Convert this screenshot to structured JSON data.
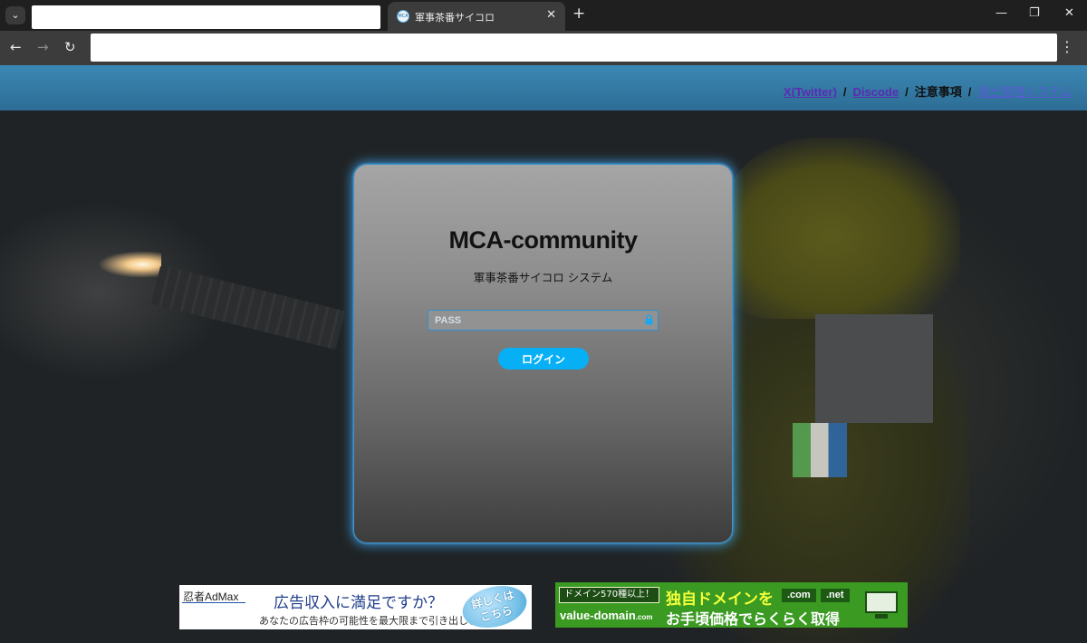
{
  "browser": {
    "tab_title": "軍事茶番サイコロ",
    "favicon_text": "MCA",
    "new_tab_symbol": "+",
    "close_tab_symbol": "✕",
    "window_controls": {
      "minimize": "—",
      "restore": "❐",
      "close": "✕"
    },
    "nav": {
      "back": "←",
      "forward": "→",
      "reload": "↻"
    },
    "menu_symbol": "⋮",
    "tab_search_symbol": "⌄"
  },
  "header": {
    "links": [
      {
        "label": "X(Twitter)"
      },
      {
        "label": "Discode"
      },
      {
        "label": "注意事項"
      },
      {
        "label": "領土管理システム"
      }
    ],
    "separator": "/"
  },
  "login": {
    "title": "MCA-community",
    "subtitle": "軍事茶番サイコロ システム",
    "password_placeholder": "PASS",
    "password_value": "",
    "submit_label": "ログイン"
  },
  "ads": {
    "admax": {
      "brand": "忍者AdMax",
      "headline": "広告収入に満足ですか？",
      "subtext": "あなたの広告枠の可能性を最大限まで引き出します",
      "cta": [
        "詳しくは",
        "こちら"
      ]
    },
    "value_domain": {
      "tag": "ドメイン570種以上！",
      "brand": "value-domain",
      "brand_suffix": ".com",
      "headline": "独自ドメインを",
      "subtext": "お手頃価格でらくらく取得",
      "tlds": [
        ".com",
        ".net"
      ]
    }
  },
  "colors": {
    "header_bg": "#3b88b4",
    "card_glow": "#3ca0e6",
    "button_bg": "#07aff5",
    "ad_green": "#3a9a22"
  }
}
